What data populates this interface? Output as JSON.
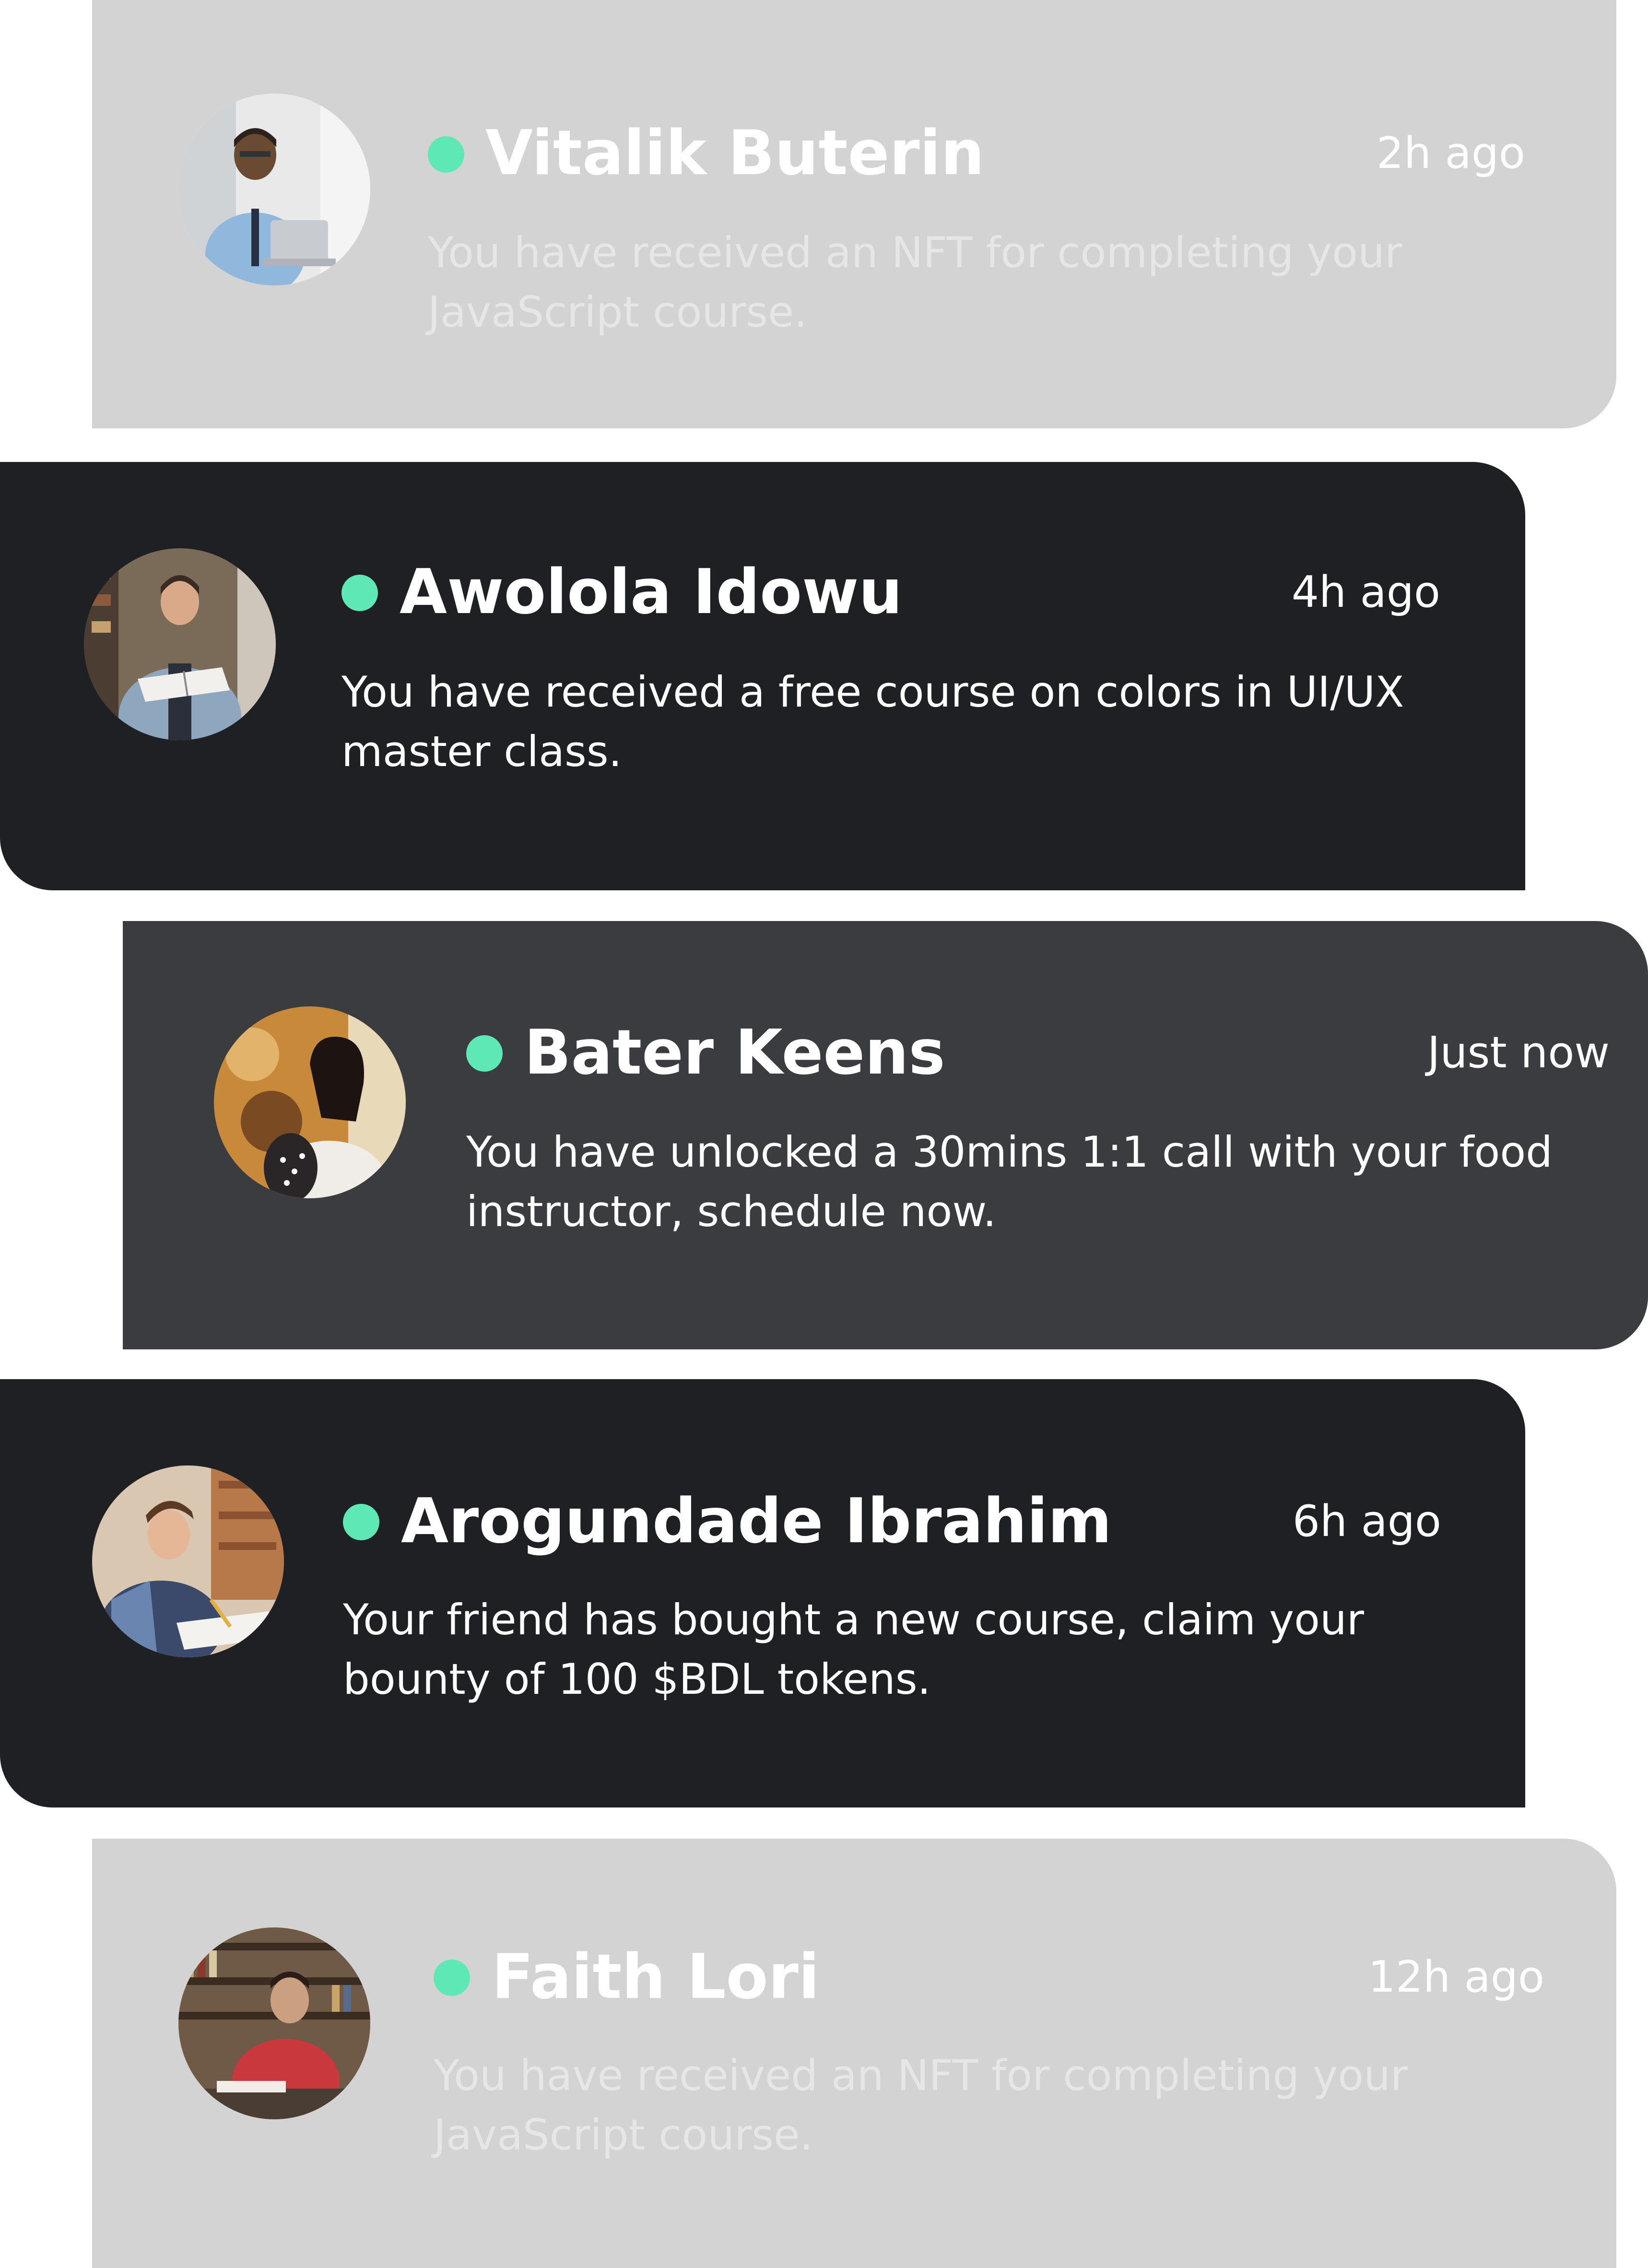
{
  "accent_dot_color": "#5de8b5",
  "notifications": [
    {
      "name": "Vitalik Buterin",
      "time": "2h ago",
      "message": "You have received an NFT for completing your JavaScript course.",
      "theme": "light",
      "avatar_icon": "avatar-man-laptop"
    },
    {
      "name": "Awolola Idowu",
      "time": "4h ago",
      "message": "You have received a free course on colors in UI/UX master class.",
      "theme": "dark",
      "avatar_icon": "avatar-man-book"
    },
    {
      "name": "Bater Keens",
      "time": "Just now",
      "message": "You have unlocked a 30mins 1:1 call with your food instructor, schedule now.",
      "theme": "mid",
      "avatar_icon": "avatar-woman-backpack"
    },
    {
      "name": "Arogundade Ibrahim",
      "time": "6h ago",
      "message": "Your friend has bought a new course, claim your bounty of 100 $BDL tokens.",
      "theme": "dark",
      "avatar_icon": "avatar-boy-writing"
    },
    {
      "name": "Faith Lori",
      "time": "12h ago",
      "message": "You have received  an NFT for completing your JavaScript course.",
      "theme": "light",
      "avatar_icon": "avatar-man-library"
    }
  ]
}
